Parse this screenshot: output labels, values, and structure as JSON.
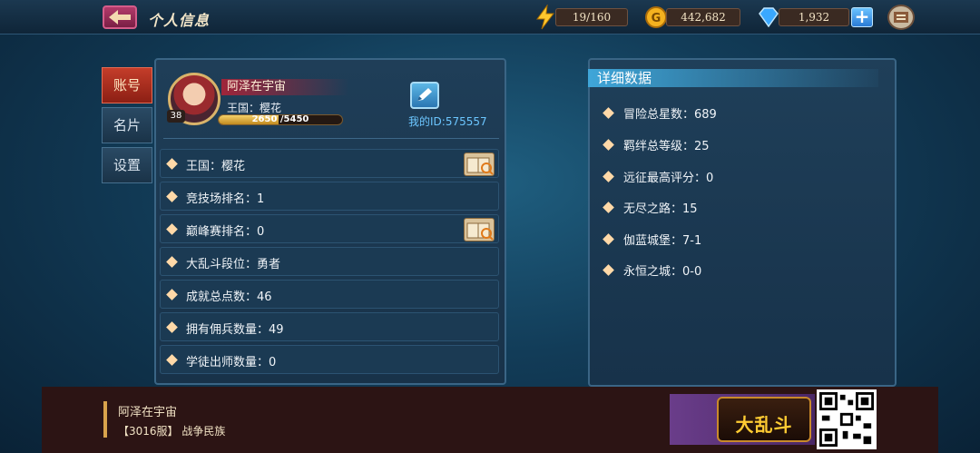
{
  "header": {
    "title": "个人信息",
    "energy": "19/160",
    "gold": "442,682",
    "gems": "1,932",
    "plus_label": "+"
  },
  "tabs": [
    {
      "label": "账号",
      "active": true
    },
    {
      "label": "名片",
      "active": false
    },
    {
      "label": "设置",
      "active": false
    }
  ],
  "profile": {
    "name": "阿泽在宇宙",
    "level": "38",
    "kingdom": "王国：樱花",
    "exp": "2650 /5450",
    "exp_fraction": 0.486,
    "my_id": "我的ID:575557"
  },
  "info_rows": [
    {
      "text": "王国：樱花",
      "has_book": true
    },
    {
      "text": "竞技场排名：1",
      "has_book": false
    },
    {
      "text": "巅峰赛排名：0",
      "has_book": true
    },
    {
      "text": "大乱斗段位：勇者",
      "has_book": false
    },
    {
      "text": "成就总点数：46",
      "has_book": false
    },
    {
      "text": "拥有佣兵数量：49",
      "has_book": false
    },
    {
      "text": "学徒出师数量：0",
      "has_book": false
    }
  ],
  "details": {
    "title": "详细数据",
    "stats": [
      "冒险总星数：689",
      "羁绊总等级：25",
      "远征最高评分：0",
      "无尽之路：15",
      "伽蓝城堡：7-1",
      "永恒之城：0-0"
    ]
  },
  "banner": {
    "name": "阿泽在宇宙",
    "sub": "【3016服】 战争民族",
    "logo": "大乱斗"
  },
  "colors": {
    "accent_blue": "#3fa6d9",
    "tab_active": "#c43d2a",
    "gold": "#f5d16a"
  }
}
